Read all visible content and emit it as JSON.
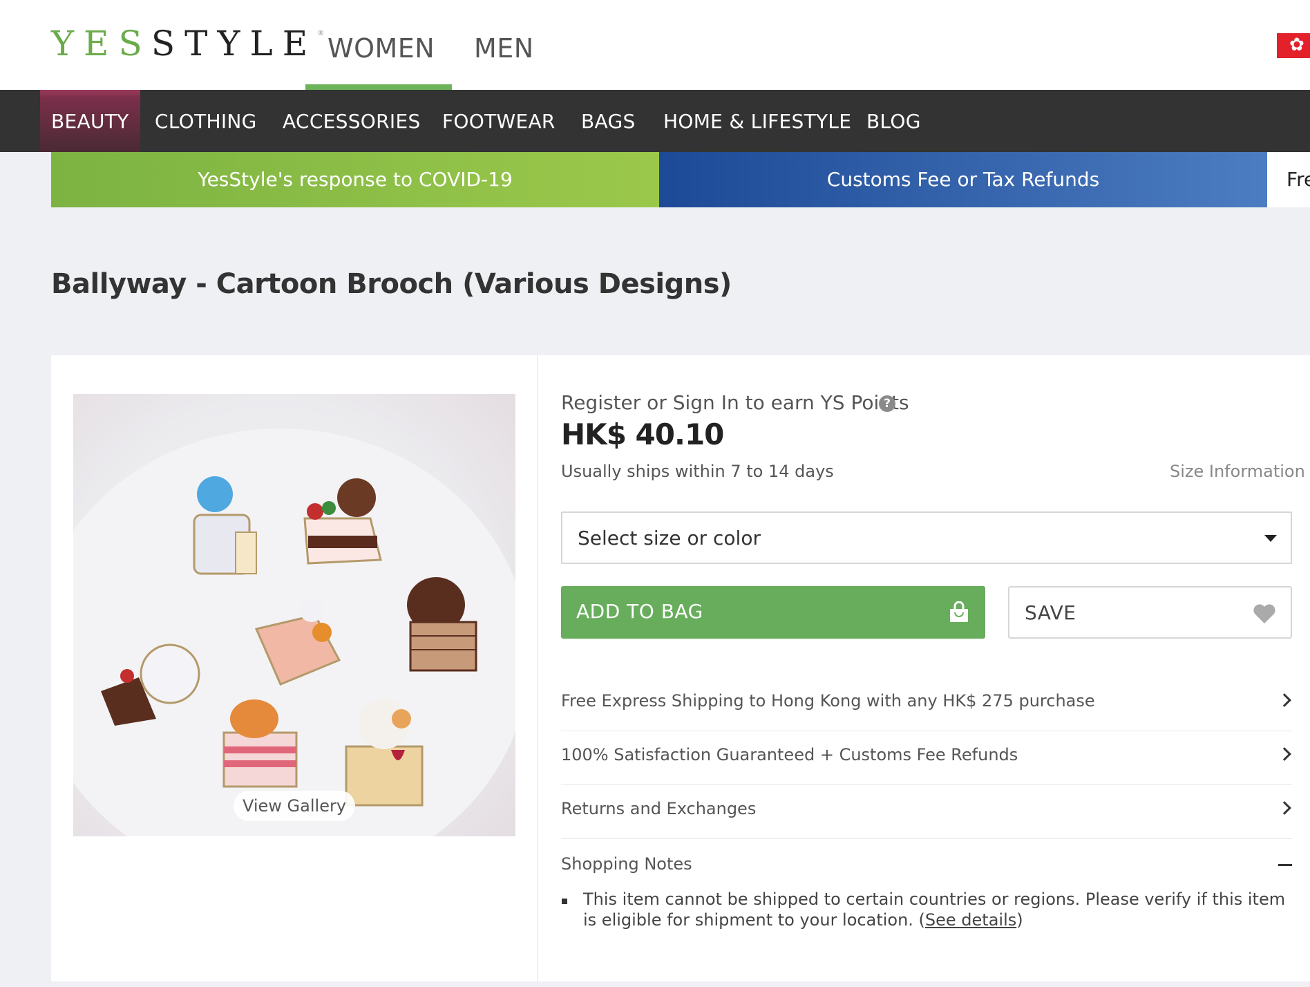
{
  "header": {
    "logo_yes": "YES",
    "logo_style": "STYLE",
    "logo_reg": "®",
    "tabs": [
      "WOMEN",
      "MEN"
    ],
    "active_tab": "WOMEN"
  },
  "category_nav": {
    "items": [
      "BEAUTY",
      "CLOTHING",
      "ACCESSORIES",
      "FOOTWEAR",
      "BAGS",
      "HOME & LIFESTYLE",
      "BLOG"
    ],
    "active": "BEAUTY"
  },
  "promos": {
    "covid": "YesStyle's response to COVID-19",
    "customs": "Customs Fee or Tax Refunds",
    "free": "Fre"
  },
  "product": {
    "title": "Ballyway - Cartoon Brooch (Various Designs)",
    "view_gallery": "View Gallery",
    "ys_points": "Register or Sign In to earn YS Points",
    "price": "HK$ 40.10",
    "ships": "Usually ships within 7 to 14 days",
    "size_info": "Size Information",
    "select_label": "Select size or color",
    "add_to_bag": "ADD TO BAG",
    "save": "SAVE"
  },
  "info_rows": [
    "Free Express Shipping to Hong Kong with any HK$ 275 purchase",
    "100% Satisfaction Guaranteed + Customs Fee Refunds",
    "Returns and Exchanges"
  ],
  "shopping_notes": {
    "title": "Shopping Notes",
    "text_before": "This item cannot be shipped to certain countries or regions. Please verify if this item is eligible for shipment to your location. (",
    "link": "See details",
    "text_after": ")"
  },
  "colors": {
    "brand_green": "#6aab4a",
    "nav_bg": "#333333",
    "add_bag_green": "#67ad5b",
    "promo_blue": "#1d4a96",
    "flag_red": "#e3212a"
  },
  "icons": [
    "hk-flag-icon",
    "help-icon",
    "caret-down-icon",
    "shopping-bag-icon",
    "heart-icon",
    "chevron-right-icon",
    "minus-icon"
  ]
}
